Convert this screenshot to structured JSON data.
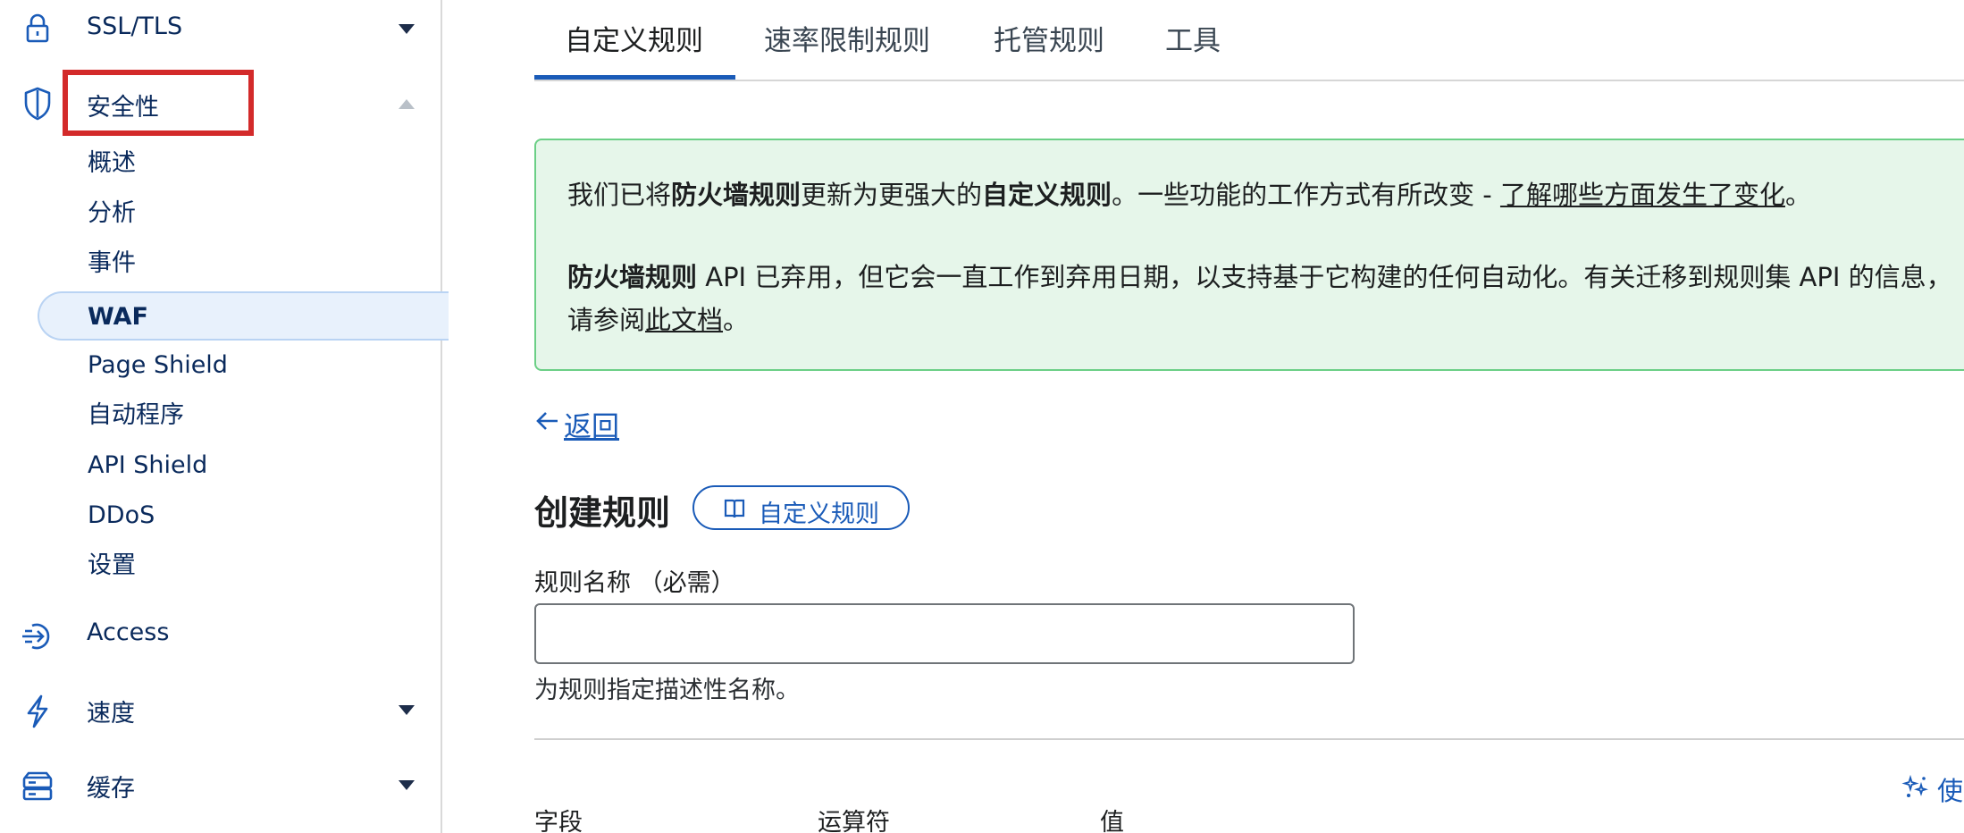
{
  "sidebar": {
    "top_item": {
      "label": "SSL/TLS"
    },
    "security": {
      "label": "安全性",
      "children": [
        {
          "label": "概述"
        },
        {
          "label": "分析"
        },
        {
          "label": "事件"
        },
        {
          "label": "WAF"
        },
        {
          "label": "Page Shield"
        },
        {
          "label": "自动程序"
        },
        {
          "label": "API Shield"
        },
        {
          "label": "DDoS"
        },
        {
          "label": "设置"
        }
      ]
    },
    "items": [
      {
        "label": "Access",
        "icon": "access-icon"
      },
      {
        "label": "速度",
        "icon": "lightning-icon"
      },
      {
        "label": "缓存",
        "icon": "cache-icon"
      }
    ]
  },
  "tabs": [
    {
      "label": "自定义规则",
      "active": true
    },
    {
      "label": "速率限制规则",
      "active": false
    },
    {
      "label": "托管规则",
      "active": false
    },
    {
      "label": "工具",
      "active": false
    }
  ],
  "notice": {
    "p1_a": "我们已将",
    "p1_b": "防火墙规则",
    "p1_c": "更新为更强大的",
    "p1_d": "自定义规则",
    "p1_e": "。一些功能的工作方式有所改变 - ",
    "p1_link": "了解哪些方面发生了变化",
    "p1_f": "。",
    "p2_a": "防火墙规则",
    "p2_b": " API 已弃用，但它会一直工作到弃用日期，以支持基于它构建的任何自动化。有关迁移到规则集 API 的信息，",
    "p3_a": "请参阅",
    "p3_link": "此文档",
    "p3_b": "。"
  },
  "back": {
    "label": "返回"
  },
  "form": {
    "title": "创建规则",
    "docs_pill": "自定义规则",
    "name_label": "规则名称 （必需）",
    "name_value": "",
    "name_help": "为规则指定描述性名称。",
    "use_link": "使",
    "columns": [
      "字段",
      "运算符",
      "值"
    ]
  },
  "colors": {
    "accent": "#1a5bb8",
    "highlight_box": "#d32a2a",
    "notice_bg": "#e6f6ea",
    "notice_border": "#6bcf86"
  }
}
